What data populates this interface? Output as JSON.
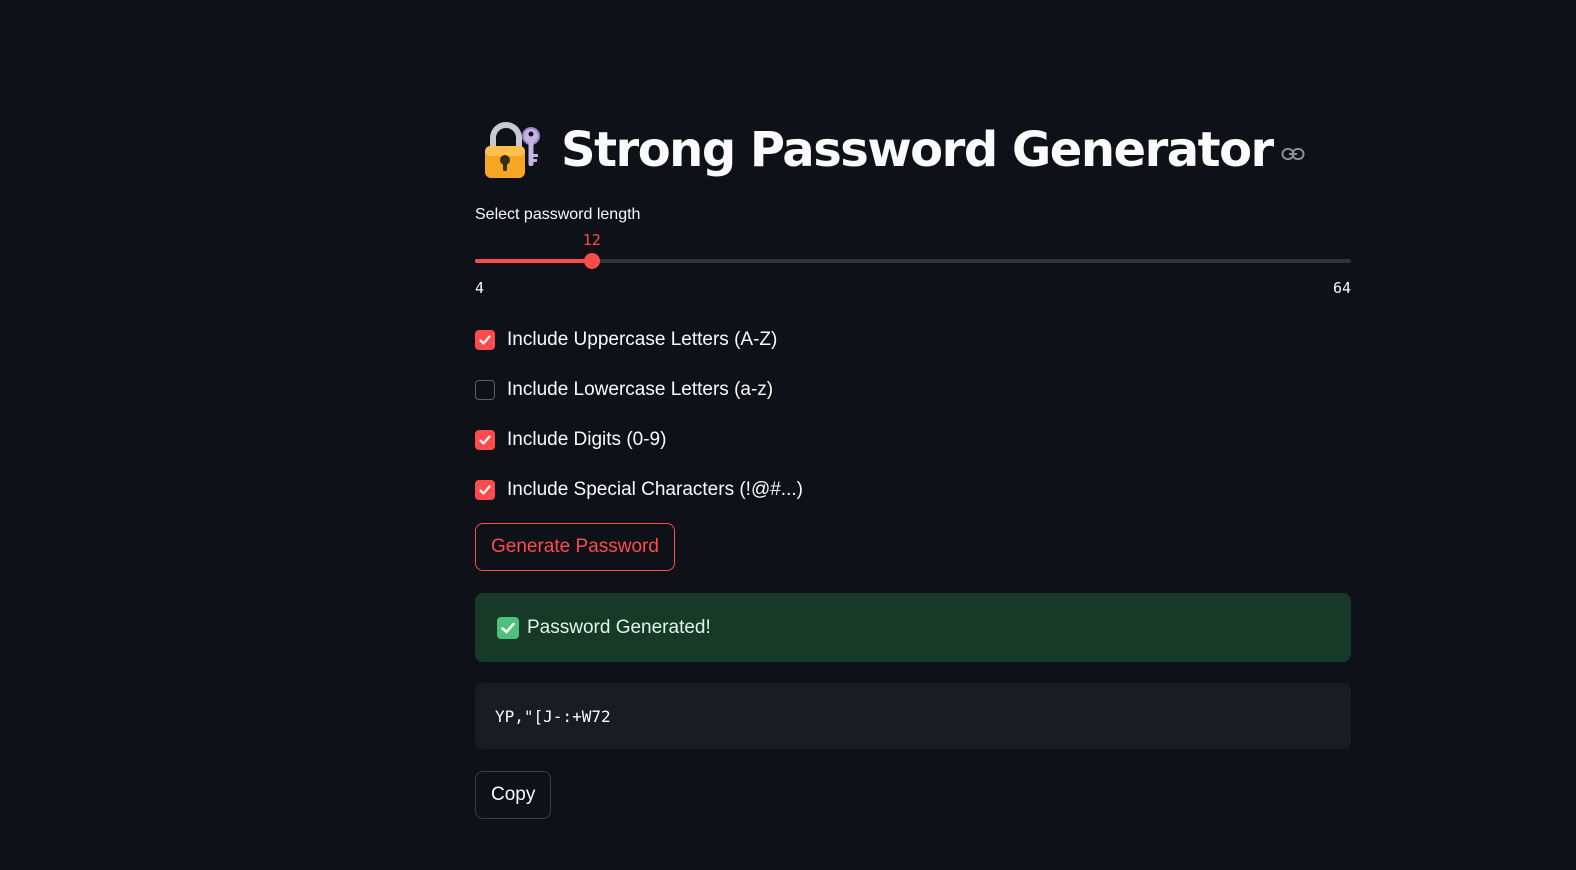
{
  "header": {
    "icon": "locked-with-key-icon",
    "title": "Strong Password Generator",
    "anchor_icon": "link-icon"
  },
  "slider": {
    "label": "Select password length",
    "value": "12",
    "min": "4",
    "max": "64",
    "accent_color": "#ff4b4b"
  },
  "options": [
    {
      "label": "Include Uppercase Letters (A-Z)",
      "checked": true
    },
    {
      "label": "Include Lowercase Letters (a-z)",
      "checked": false
    },
    {
      "label": "Include Digits (0-9)",
      "checked": true
    },
    {
      "label": "Include Special Characters (!@#...)",
      "checked": true
    }
  ],
  "actions": {
    "generate_label": "Generate Password",
    "copy_label": "Copy"
  },
  "status": {
    "icon": "check-mark-button-icon",
    "message": "Password Generated!",
    "color": "#173928"
  },
  "result": {
    "password": "YP,\"[J-:+W72"
  },
  "colors": {
    "background": "#0e1117",
    "primary": "#ff4b4b",
    "success_bg": "#173928",
    "code_bg": "#1a1c24"
  }
}
